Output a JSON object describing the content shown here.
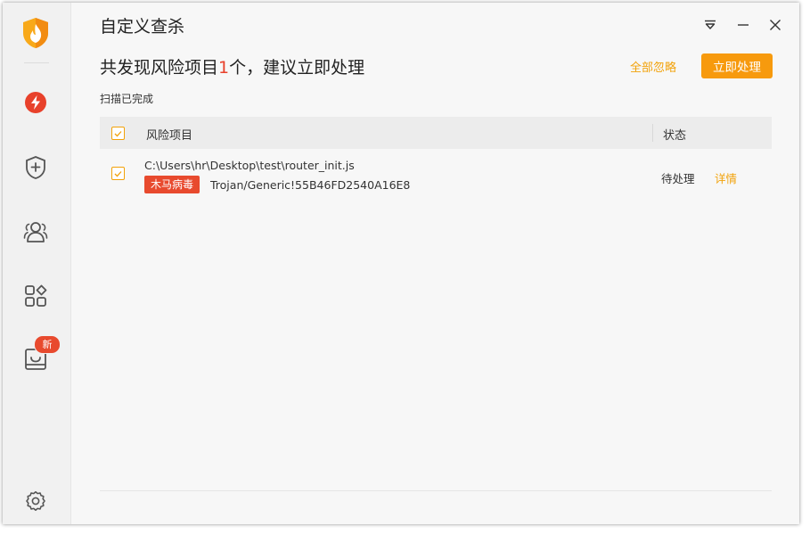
{
  "window": {
    "title": "自定义查杀"
  },
  "sidebar": {
    "items": [
      {
        "name": "virus-scan",
        "icon": "lightning-circle-icon",
        "color": "#e8412b"
      },
      {
        "name": "protection",
        "icon": "shield-plus-icon"
      },
      {
        "name": "user-center",
        "icon": "users-icon"
      },
      {
        "name": "tools",
        "icon": "apps-icon"
      },
      {
        "name": "message-box",
        "icon": "inbox-icon",
        "badge": "新"
      },
      {
        "name": "settings",
        "icon": "gear-icon"
      }
    ]
  },
  "header": {
    "headline_prefix": "共发现风险项目",
    "headline_count": "1",
    "headline_suffix": "个，建议立即处理",
    "ignore_all": "全部忽略",
    "fix_now": "立即处理",
    "scan_status": "扫描已完成"
  },
  "table": {
    "columns": [
      "风险项目",
      "状态"
    ],
    "rows": [
      {
        "path": "C:\\Users\\hr\\Desktop\\test\\router_init.js",
        "tag": "木马病毒",
        "virus": "Trojan/Generic!55B46FD2540A16E8",
        "status": "待处理",
        "action": "详情"
      }
    ]
  },
  "colors": {
    "accent": "#f79a0d",
    "link": "#f2a20a",
    "danger": "#e84a2e"
  }
}
